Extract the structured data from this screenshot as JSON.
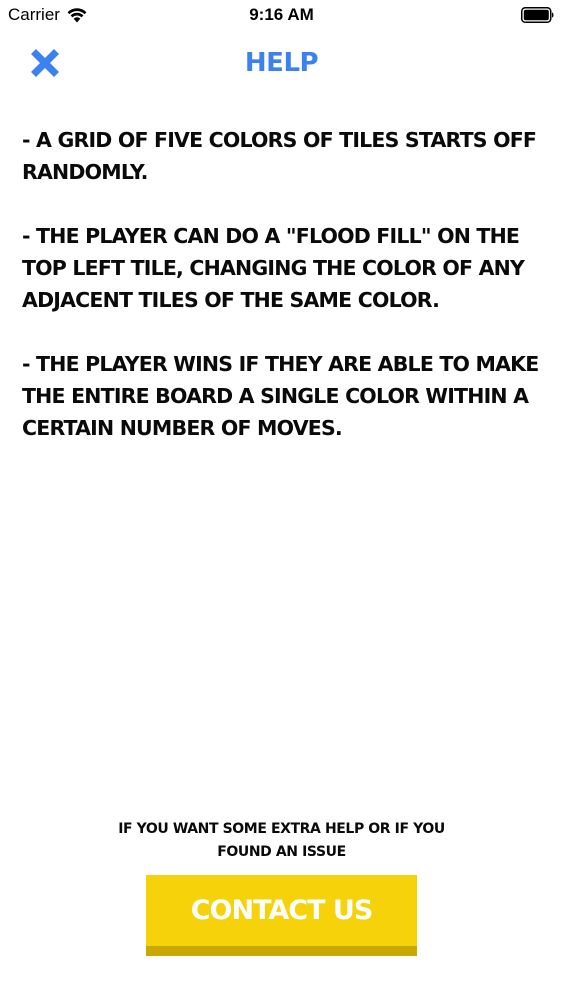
{
  "status_bar": {
    "carrier": "Carrier",
    "time": "9:16 AM",
    "wifi_icon": "wifi-icon",
    "battery_icon": "battery-icon"
  },
  "header": {
    "title": "HELP",
    "close_icon": "close-icon",
    "accent_color": "#3b82f0"
  },
  "instructions": [
    "- A GRID OF FIVE COLORS OF TILES STARTS OFF RANDOMLY.",
    "- THE PLAYER CAN DO A \"FLOOD FILL\" ON THE TOP LEFT TILE, CHANGING THE COLOR OF ANY ADJACENT TILES OF THE SAME COLOR.",
    "- THE PLAYER WINS IF THEY ARE ABLE TO MAKE THE ENTIRE BOARD A SINGLE COLOR WITHIN A CERTAIN NUMBER OF MOVES."
  ],
  "footer": {
    "note": "IF YOU WANT SOME EXTRA HELP OR IF YOU FOUND AN ISSUE",
    "contact_label": "CONTACT US",
    "button_color": "#f5d20a",
    "button_shadow_color": "#c9a800"
  }
}
